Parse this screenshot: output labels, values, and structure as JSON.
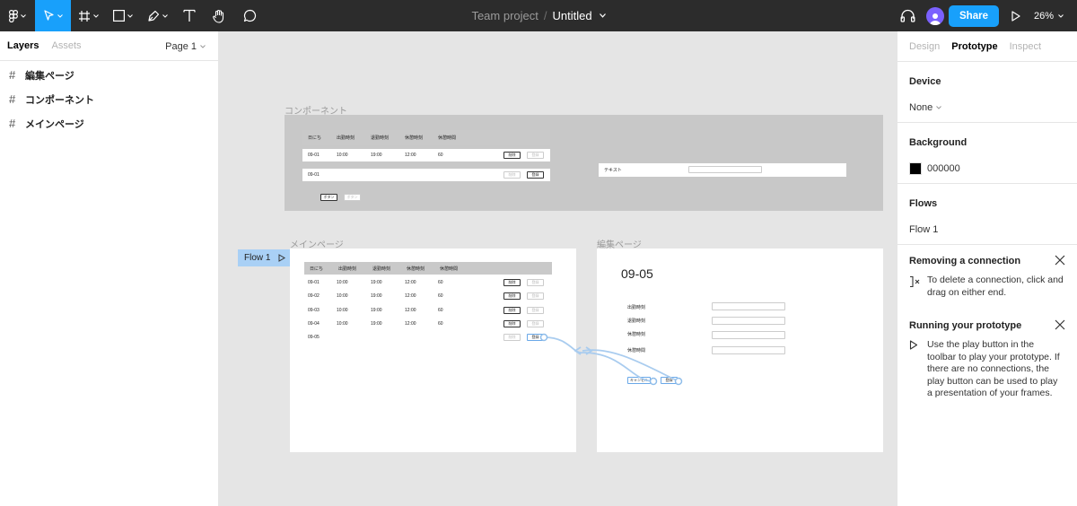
{
  "toolbar": {
    "tools": [
      "figma-menu",
      "move-tool",
      "frame-tool",
      "shape-tool",
      "pen-tool",
      "text-tool",
      "hand-tool",
      "comment-tool"
    ],
    "team": "Team project",
    "separator": "/",
    "file": "Untitled",
    "share_label": "Share",
    "zoom": "26%"
  },
  "left_panel": {
    "tabs": [
      "Layers",
      "Assets"
    ],
    "page": "Page 1",
    "layers": [
      "編集ページ",
      "コンポーネント",
      "メインページ"
    ]
  },
  "right_panel": {
    "tabs": [
      "Design",
      "Prototype",
      "Inspect"
    ],
    "device": {
      "title": "Device",
      "value": "None"
    },
    "background": {
      "title": "Background",
      "hex": "000000",
      "color": "#000000"
    },
    "flows": {
      "title": "Flows",
      "items": [
        "Flow 1"
      ]
    },
    "removing": {
      "title": "Removing a connection",
      "text": "To delete a connection, click and drag on either end."
    },
    "running": {
      "title": "Running your prototype",
      "text": "Use the play button in the toolbar to play your prototype. If there are no connections, the play button can be used to play a presentation of your frames."
    }
  },
  "canvas": {
    "component_frame": {
      "label": "コンポーネント",
      "headers": [
        "日にち",
        "出勤時刻",
        "退勤時刻",
        "休憩時刻",
        "休憩時間"
      ],
      "row1": [
        "09-01",
        "10:00",
        "19:00",
        "12:00",
        "60"
      ],
      "row2_date": "09-01",
      "btn_delete": "削除",
      "btn_register": "登録",
      "btn_button": "ボタン",
      "btn_button2": "ボタン",
      "text_label": "テキスト"
    },
    "main_frame": {
      "label": "メインページ",
      "flow_tag": "Flow 1",
      "headers": [
        "日にち",
        "出勤時刻",
        "退勤時刻",
        "休憩時刻",
        "休憩時間"
      ],
      "rows": [
        [
          "09-01",
          "10:00",
          "19:00",
          "12:00",
          "60"
        ],
        [
          "09-02",
          "10:00",
          "19:00",
          "12:00",
          "60"
        ],
        [
          "09-03",
          "10:00",
          "19:00",
          "12:00",
          "60"
        ],
        [
          "09-04",
          "10:00",
          "19:00",
          "12:00",
          "60"
        ]
      ],
      "last_date": "09-05",
      "btn_delete": "削除",
      "btn_register": "登録"
    },
    "edit_frame": {
      "label": "編集ページ",
      "date": "09-05",
      "fields": [
        "出勤時刻",
        "退勤時刻",
        "休憩時刻",
        "休憩時間"
      ],
      "btn_cancel": "キャンセル",
      "btn_save": "登録"
    }
  }
}
